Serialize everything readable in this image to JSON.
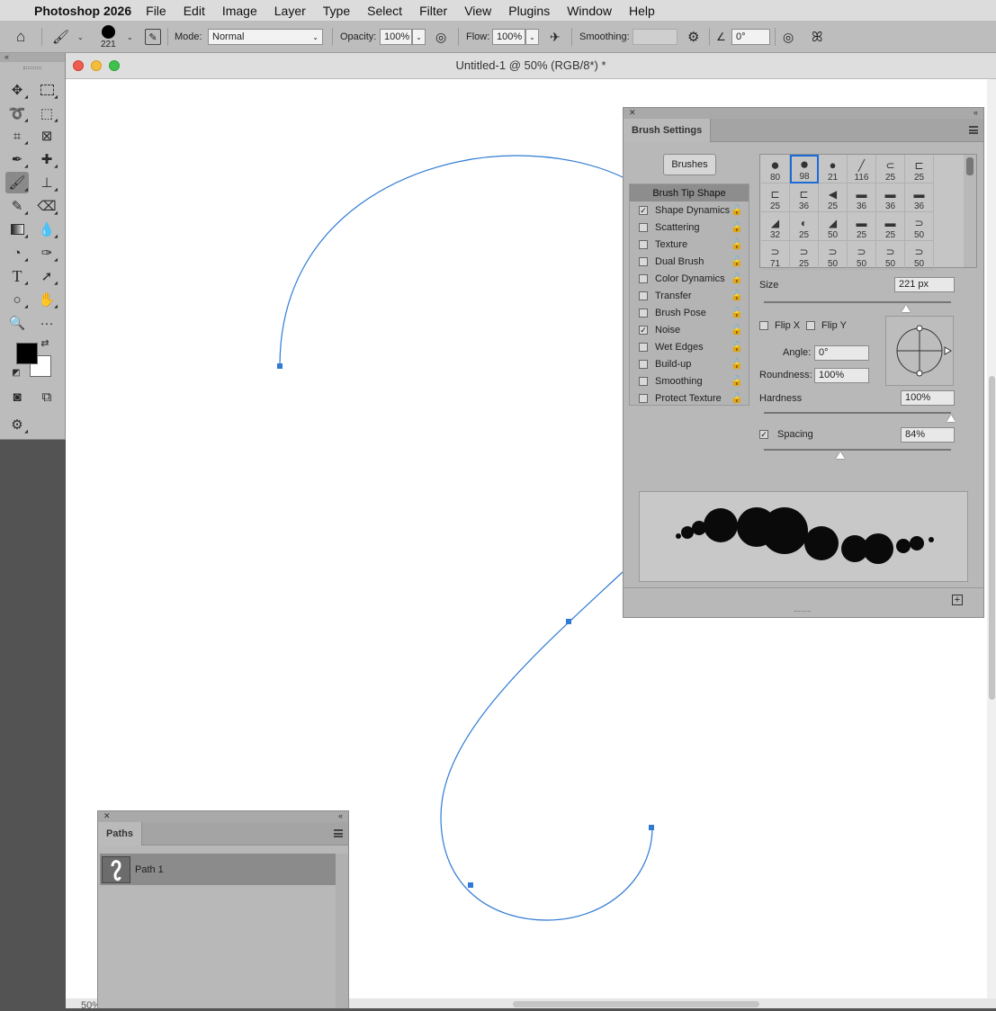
{
  "menubar": {
    "app": "Photoshop 2026",
    "items": [
      "File",
      "Edit",
      "Image",
      "Layer",
      "Type",
      "Select",
      "Filter",
      "View",
      "Plugins",
      "Window",
      "Help"
    ]
  },
  "options": {
    "brush_size": "221",
    "mode_label": "Mode:",
    "mode_value": "Normal",
    "opacity_label": "Opacity:",
    "opacity_value": "100%",
    "flow_label": "Flow:",
    "flow_value": "100%",
    "smoothing_label": "Smoothing:",
    "angle_value": "0°"
  },
  "document": {
    "title": "Untitled-1 @ 50% (RGB/8*) *",
    "zoom": "50%"
  },
  "brush_settings": {
    "tab": "Brush Settings",
    "brushes_button": "Brushes",
    "options": [
      {
        "label": "Brush Tip Shape",
        "checked": null,
        "selected": true
      },
      {
        "label": "Shape Dynamics",
        "checked": true
      },
      {
        "label": "Scattering",
        "checked": false
      },
      {
        "label": "Texture",
        "checked": false
      },
      {
        "label": "Dual Brush",
        "checked": false
      },
      {
        "label": "Color Dynamics",
        "checked": false
      },
      {
        "label": "Transfer",
        "checked": false
      },
      {
        "label": "Brush Pose",
        "checked": false
      },
      {
        "label": "Noise",
        "checked": true
      },
      {
        "label": "Wet Edges",
        "checked": false
      },
      {
        "label": "Build-up",
        "checked": false
      },
      {
        "label": "Smoothing",
        "checked": false
      },
      {
        "label": "Protect Texture",
        "checked": false
      }
    ],
    "tips": [
      "80",
      "98",
      "21",
      "116",
      "25",
      "25",
      "25",
      "36",
      "25",
      "36",
      "36",
      "36",
      "32",
      "25",
      "50",
      "25",
      "25",
      "50",
      "71",
      "25",
      "50",
      "50",
      "50",
      "50"
    ],
    "selected_tip": "98",
    "size_label": "Size",
    "size_value": "221 px",
    "size_fraction": 0.76,
    "flip_x": "Flip X",
    "flip_y": "Flip Y",
    "angle_label": "Angle:",
    "angle_value": "0°",
    "roundness_label": "Roundness:",
    "roundness_value": "100%",
    "hardness_label": "Hardness",
    "hardness_value": "100%",
    "hardness_fraction": 1.0,
    "spacing_label": "Spacing",
    "spacing_value": "84%",
    "spacing_checked": true,
    "spacing_fraction": 0.41
  },
  "paths": {
    "tab": "Paths",
    "items": [
      "Path 1"
    ]
  },
  "colors": {
    "foreground": "#000000",
    "background": "#ffffff",
    "path_stroke": "#2f7bd4",
    "selection": "#1b6bd6"
  }
}
